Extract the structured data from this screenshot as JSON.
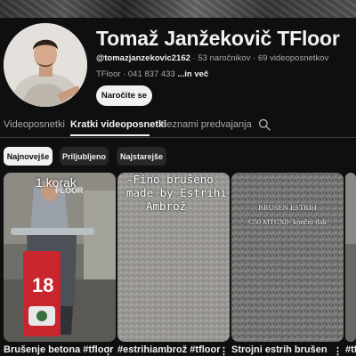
{
  "channel": {
    "name": "Tomaž Janžekovič TFloor",
    "handle": "@tomazjanzekovic2162",
    "subscribers": "53 naročnikov",
    "videos": "69 videoposnetkov",
    "description": "TFloor · 041 837 433",
    "more": "...in več",
    "subscribe_label": "Naročite se"
  },
  "tabs": [
    {
      "label": "Videoposnetki",
      "active": false
    },
    {
      "label": "Kratki videoposnetki",
      "active": true
    },
    {
      "label": "Seznami predvajanja",
      "active": false
    }
  ],
  "filters": [
    {
      "label": "Najnovejše",
      "active": true
    },
    {
      "label": "Priljubljeno",
      "active": false
    },
    {
      "label": "Najstarejše",
      "active": false
    }
  ],
  "shorts": [
    {
      "title": "Brušenje betona #tfloor",
      "overlay": "1.korak",
      "sign": "18",
      "logo": "FLOOR"
    },
    {
      "title": "#estrihiambrož #tfloor",
      "overlay": [
        "-Fino brušeno",
        "made by Estrihi",
        "Ambrož"
      ]
    },
    {
      "title": "Strojni estrih brušen",
      "overlay": [
        "BRUSEN ESTRIH",
        "C50 MTCX8- končni tlak"
      ]
    },
    {
      "title": "#tf"
    }
  ],
  "colors": {
    "background": "#0f0f0f",
    "text": "#f1f1f1",
    "muted": "#aaaaaa",
    "chip": "#272727"
  },
  "icons": {
    "search": "search-icon",
    "more": "vertical-dots-icon"
  }
}
